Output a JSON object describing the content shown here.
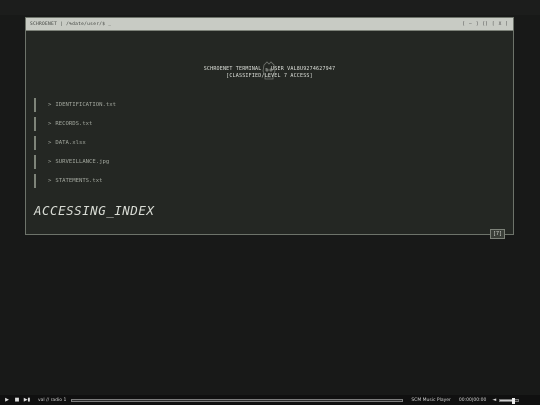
{
  "window": {
    "title": "SCHROENET | /%date/user/$ _",
    "controls": [
      "[",
      "–",
      "]",
      "[]",
      "[",
      "X",
      "]"
    ]
  },
  "header": {
    "line1": "SCHROENET TERMINAL - USER VAL8U9274627947",
    "line2": "[CLASSIFIED/LEVEL 7 ACCESS]"
  },
  "files": [
    {
      "label": "IDENTIFICATION.txt"
    },
    {
      "label": "RECORDS.txt"
    },
    {
      "label": "DATA.xlsx"
    },
    {
      "label": "SURVEILLANCE.jpg"
    },
    {
      "label": "STATEMENTS.txt"
    }
  ],
  "status": {
    "accessing": "ACCESSING_INDEX",
    "counter": "[7]"
  },
  "player": {
    "track": "val // radio 1",
    "name": "SCM Music Player",
    "time": "00:00|00:00",
    "progress": 0,
    "volume": 0.75,
    "icons": [
      "play-icon",
      "stop-icon",
      "next-icon",
      "volume-icon"
    ]
  }
}
